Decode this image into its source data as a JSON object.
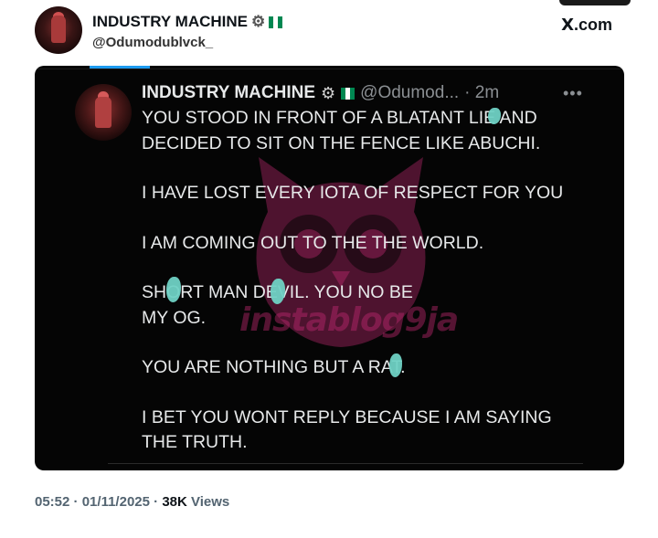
{
  "author": {
    "name": "INDUSTRY MACHINE",
    "handle": "@Odumodublvck_",
    "badges": [
      "gear-icon",
      "nigeria-flag-icon"
    ]
  },
  "source": {
    "label": "X.com",
    "x": "X",
    "dotcom": ".com"
  },
  "quoted": {
    "name": "INDUSTRY MACHINE",
    "handle": "@Odumod...",
    "time": "· 2m",
    "more": "•••",
    "lines": [
      "YOU STOOD IN FRONT OF A BLATANT LIE AND",
      "DECIDED TO SIT ON THE FENCE LIKE ABUCHI.",
      "I HAVE LOST EVERY IOTA OF RESPECT FOR YOU",
      "I AM COMING OUT TO THE THE WORLD.",
      "SHORT MAN DEVIL. YOU NO BE",
      "MY OG.",
      "YOU ARE NOTHING BUT A RAT.",
      "I BET YOU WONT REPLY BECAUSE I AM SAYING",
      "THE TRUTH."
    ]
  },
  "watermark": {
    "text": "instablog9ja",
    "color": "#c62a74"
  },
  "meta": {
    "time": "05:52",
    "sep1": " · ",
    "date": "01/11/2025",
    "sep2": " · ",
    "views_count": "38K",
    "views_label": " Views"
  },
  "colors": {
    "card_bg": "#050505",
    "accent": "#1d9bf0",
    "blot": "#6fd1c4"
  }
}
